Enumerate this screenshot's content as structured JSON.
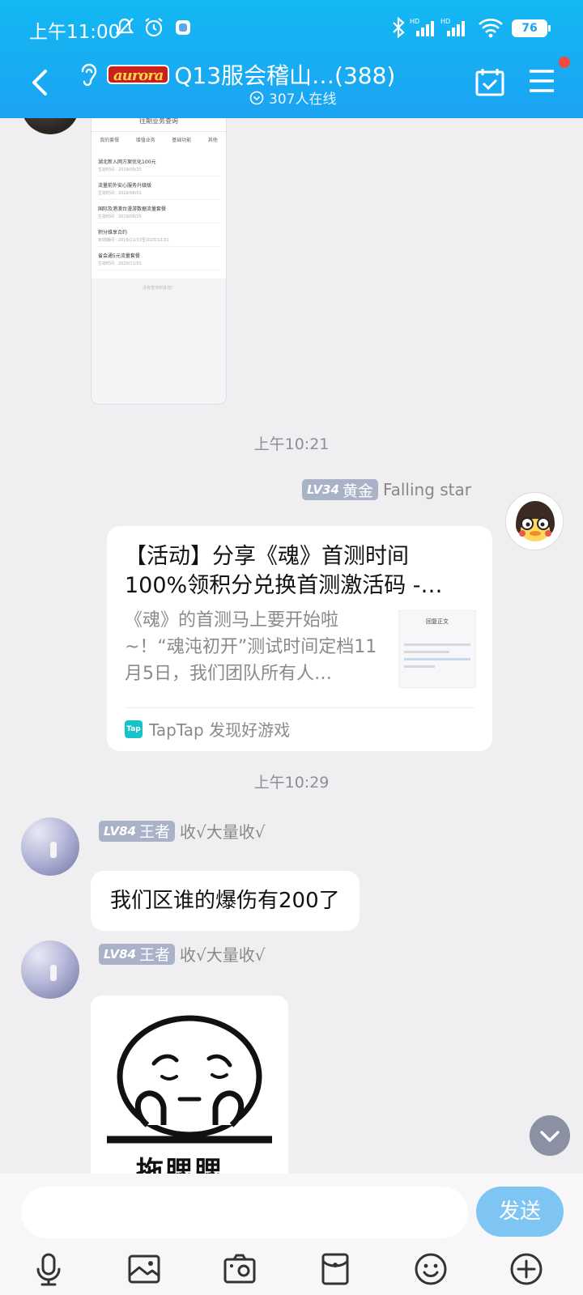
{
  "status_bar": {
    "time": "上午11:00",
    "battery": "76"
  },
  "header": {
    "logo_text": "aurora",
    "title": "Q13服会稽山…(388)",
    "online": "307人在线"
  },
  "chat": {
    "screenshot_message": {
      "title": "往期业务查询",
      "tabs": [
        "我的套餐",
        "增值业务",
        "基础功能",
        "其他"
      ],
      "items": [
        {
          "name": "湖北新入网方案优化100元",
          "sub": "生效时间：2019/09/25"
        },
        {
          "name": "流量前外安心服务升级版",
          "sub": "生效时间：2019/06/01"
        },
        {
          "name": "国际及港澳台漫游数据流量套餐",
          "sub": "生效时间：2019/08/25"
        },
        {
          "name": "积分维享合约",
          "sub": "有效期间：2019/11/13至2020/12/31"
        },
        {
          "name": "省会通5元流量套餐",
          "sub": "生效时间：2020/11/01"
        }
      ],
      "footer": "没有查询到其他？"
    },
    "timestamp_1": "上午10:21",
    "msg_star": {
      "level": "LV34",
      "rank": "黄金",
      "name": "Falling star",
      "card_title": "【活动】分享《魂》首测时间 100%领积分兑换首测激活码 -…",
      "card_desc": "《魂》的首测马上要开始啦~！“魂沌初开”测试时间定档11月5日，我们团队所有人…",
      "card_source_icon": "Tap",
      "card_source": "TapTap 发现好游戏",
      "thumb_title": "回复正文"
    },
    "timestamp_2": "上午10:29",
    "msg_king_1": {
      "level": "LV84",
      "rank": "王者",
      "name": "收√大量收√",
      "text": "我们区谁的爆伤有200了"
    },
    "msg_king_2": {
      "level": "LV84",
      "rank": "王者",
      "name": "收√大量收√",
      "sticker_text": "拖腮腮"
    }
  },
  "input_bar": {
    "placeholder": "",
    "send_label": "发送",
    "tools": [
      "mic-icon",
      "image-icon",
      "camera-icon",
      "red-packet-icon",
      "emoji-icon",
      "plus-icon"
    ]
  },
  "colors": {
    "header": "#13b8f3",
    "send": "#7ec5f4",
    "badge": "#f04b3c",
    "level": "#aab2c8"
  }
}
